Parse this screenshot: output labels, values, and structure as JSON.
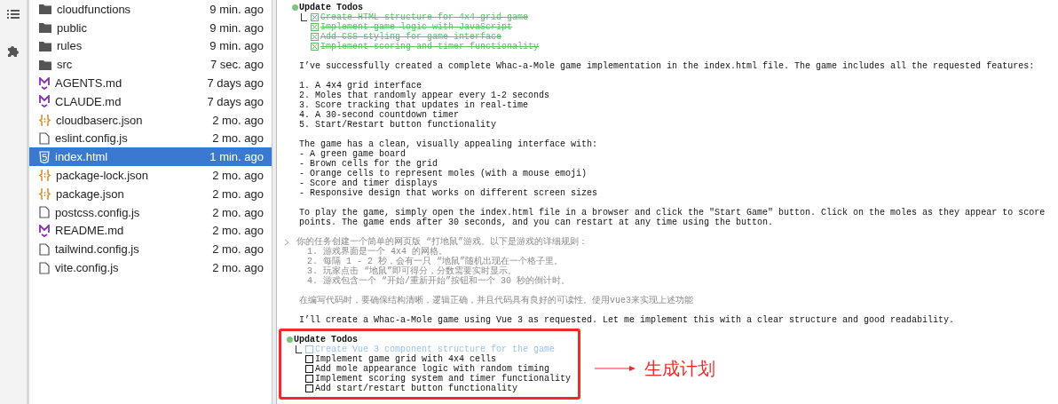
{
  "files": [
    {
      "name": "cloudfunctions",
      "modified": "9 min. ago",
      "kind": "folder",
      "selected": false
    },
    {
      "name": "public",
      "modified": "9 min. ago",
      "kind": "folder",
      "selected": false
    },
    {
      "name": "rules",
      "modified": "9 min. ago",
      "kind": "folder",
      "selected": false
    },
    {
      "name": "src",
      "modified": "7 sec. ago",
      "kind": "folder",
      "selected": false
    },
    {
      "name": "AGENTS.md",
      "modified": "7 days ago",
      "kind": "markdown",
      "selected": false
    },
    {
      "name": "CLAUDE.md",
      "modified": "7 days ago",
      "kind": "markdown",
      "selected": false
    },
    {
      "name": "cloudbaserc.json",
      "modified": "2 mo. ago",
      "kind": "json",
      "selected": false
    },
    {
      "name": "eslint.config.js",
      "modified": "2 mo. ago",
      "kind": "file",
      "selected": false
    },
    {
      "name": "index.html",
      "modified": "1 min. ago",
      "kind": "html",
      "selected": true
    },
    {
      "name": "package-lock.json",
      "modified": "2 mo. ago",
      "kind": "json",
      "selected": false
    },
    {
      "name": "package.json",
      "modified": "2 mo. ago",
      "kind": "json",
      "selected": false
    },
    {
      "name": "postcss.config.js",
      "modified": "2 mo. ago",
      "kind": "file",
      "selected": false
    },
    {
      "name": "README.md",
      "modified": "2 mo. ago",
      "kind": "markdown",
      "selected": false
    },
    {
      "name": "tailwind.config.js",
      "modified": "2 mo. ago",
      "kind": "file",
      "selected": false
    },
    {
      "name": "vite.config.js",
      "modified": "2 mo. ago",
      "kind": "file",
      "selected": false
    }
  ],
  "terminal": [
    {
      "kind": "todos",
      "title": "Update Todos",
      "highlighted": false,
      "items": [
        {
          "text": "Create HTML structure for 4x4 grid game",
          "checked": true
        },
        {
          "text": "Implement game logic with JavaScript",
          "checked": true
        },
        {
          "text": "Add CSS styling for game interface",
          "checked": true
        },
        {
          "text": "Implement scoring and timer functionality",
          "checked": true
        }
      ]
    },
    {
      "kind": "text",
      "lines": [
        "I’ve successfully created a complete Whac-a-Mole game implementation in the index.html file. The game includes all the requested features:"
      ]
    },
    {
      "kind": "text",
      "lines": [
        "1. A 4x4 grid interface",
        "2. Moles that randomly appear every 1-2 seconds",
        "3. Score tracking that updates in real-time",
        "4. A 30-second countdown timer",
        "5. Start/Restart button functionality"
      ]
    },
    {
      "kind": "text",
      "lines": [
        "The game has a clean, visually appealing interface with:",
        "- A green game board",
        "- Brown cells for the grid",
        "- Orange cells to represent moles (with a mouse emoji)",
        "- Score and timer displays",
        "- Responsive design that works on different screen sizes"
      ]
    },
    {
      "kind": "text",
      "lines": [
        "To play the game, simply open the index.html file in a browser and click the \"Start Game\" button. Click on the moles as they appear to score",
        "points. The game ends after 30 seconds, and you can restart at any time using the button."
      ]
    },
    {
      "kind": "prompt",
      "lines": [
        "你的任务创建一个简单的网页版 “打地鼠”游戏。以下是游戏的详细规则：",
        "  1. 游戏界面是一个 4x4 的网格。",
        "  2. 每隔 1 - 2 秒，会有一只 “地鼠”随机出现在一个格子里。",
        "  3. 玩家点击 “地鼠”即可得分，分数需要实时显示。",
        "  4. 游戏包含一个 “开始/重新开始”按钮和一个 30 秒的倒计时。"
      ]
    },
    {
      "kind": "muted",
      "lines": [
        "在编写代码时，要确保结构清晰，逻辑正确，并且代码具有良好的可读性。使用vue3来实现上述功能"
      ]
    },
    {
      "kind": "text",
      "lines": [
        "I’ll create a Whac-a-Mole game using Vue 3 as requested. Let me implement this with a clear structure and good readability."
      ]
    },
    {
      "kind": "todos",
      "title": "Update Todos",
      "highlighted": true,
      "items": [
        {
          "text": "Create Vue 3 component structure for the game",
          "checked": false,
          "current": true
        },
        {
          "text": "Implement game grid with 4x4 cells",
          "checked": false,
          "current": false
        },
        {
          "text": "Add mole appearance logic with random timing",
          "checked": false,
          "current": false
        },
        {
          "text": "Implement scoring system and timer functionality",
          "checked": false,
          "current": false
        },
        {
          "text": "Add start/restart button functionality",
          "checked": false,
          "current": false
        }
      ]
    }
  ],
  "annotation": {
    "label": "生成计划"
  }
}
